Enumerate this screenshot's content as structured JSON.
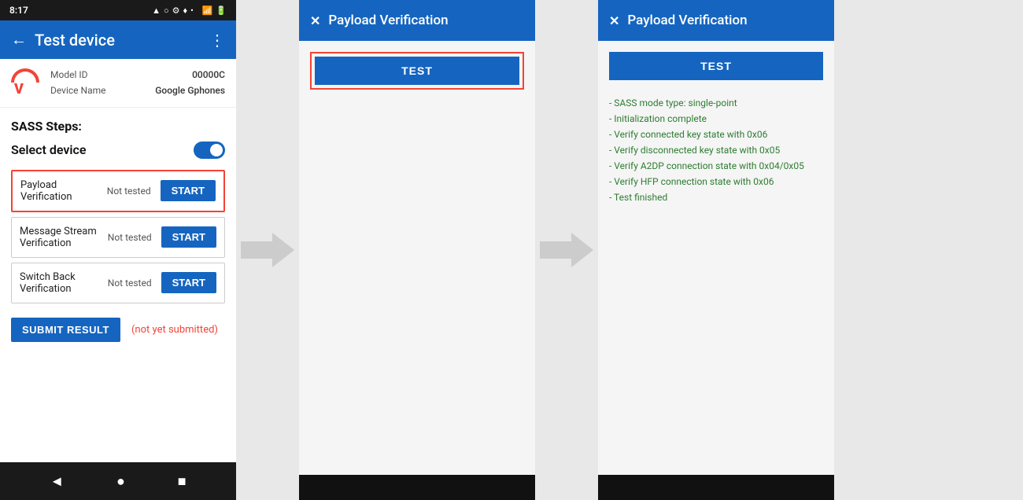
{
  "phone": {
    "status_bar": {
      "time": "8:17",
      "icons": "▲ ○ ⚙ ♦ •"
    },
    "top_bar": {
      "back_label": "←",
      "title": "Test device",
      "more_label": "⋮"
    },
    "device_info": {
      "model_id_label": "Model ID",
      "model_id_value": "00000C",
      "device_name_label": "Device Name",
      "device_name_value": "Google Gphones"
    },
    "sass_steps_title": "SASS Steps:",
    "select_device_label": "Select device",
    "steps": [
      {
        "name": "Payload Verification",
        "status": "Not tested",
        "start_label": "START",
        "highlighted": true
      },
      {
        "name": "Message Stream Verification",
        "status": "Not tested",
        "start_label": "START",
        "highlighted": false
      },
      {
        "name": "Switch Back Verification",
        "status": "Not tested",
        "start_label": "START",
        "highlighted": false
      }
    ],
    "submit_btn_label": "SUBMIT RESULT",
    "not_submitted_label": "(not yet submitted)",
    "navbar": {
      "back": "◄",
      "home": "●",
      "recent": "■"
    }
  },
  "dialog1": {
    "close_label": "✕",
    "title": "Payload Verification",
    "test_btn_label": "TEST"
  },
  "dialog2": {
    "close_label": "✕",
    "title": "Payload Verification",
    "test_btn_label": "TEST",
    "results": [
      "- SASS mode type: single-point",
      "- Initialization complete",
      "- Verify connected key state with 0x06",
      "- Verify disconnected key state with 0x05",
      "- Verify A2DP connection state with 0x04/0x05",
      "- Verify HFP connection state with 0x06",
      "- Test finished"
    ]
  },
  "colors": {
    "primary": "#1565c0",
    "danger": "#f44336",
    "success": "#2e7d32"
  }
}
